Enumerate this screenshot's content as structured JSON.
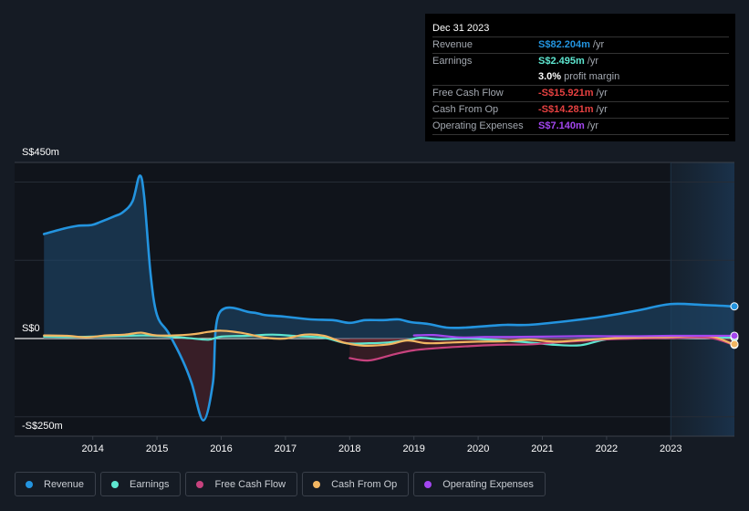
{
  "tooltip": {
    "date": "Dec 31 2023",
    "rows": [
      {
        "label": "Revenue",
        "value": "S$82.204m",
        "suffix": "/yr",
        "color": "#2394df"
      },
      {
        "label": "Earnings",
        "value": "S$2.495m",
        "suffix": "/yr",
        "color": "#5ee6d0"
      },
      {
        "label": "",
        "value": "3.0%",
        "suffix": "profit margin",
        "color": "#ffffff"
      },
      {
        "label": "Free Cash Flow",
        "value": "-S$15.921m",
        "suffix": "/yr",
        "color": "#e64141"
      },
      {
        "label": "Cash From Op",
        "value": "-S$14.281m",
        "suffix": "/yr",
        "color": "#e64141"
      },
      {
        "label": "Operating Expenses",
        "value": "S$7.140m",
        "suffix": "/yr",
        "color": "#a346f0"
      }
    ]
  },
  "legend": [
    {
      "label": "Revenue",
      "color": "#2394df"
    },
    {
      "label": "Earnings",
      "color": "#5ee6d0"
    },
    {
      "label": "Free Cash Flow",
      "color": "#c7427e"
    },
    {
      "label": "Cash From Op",
      "color": "#f2b662"
    },
    {
      "label": "Operating Expenses",
      "color": "#a346f0"
    }
  ],
  "chart_data": {
    "type": "area",
    "title": "",
    "xlabel": "",
    "ylabel": "",
    "currency": "S$",
    "unit": "m",
    "ylim": [
      -250,
      450
    ],
    "xlim": [
      2012.65,
      2023.98
    ],
    "y_tick_labels": [
      {
        "value": 450,
        "label": "S$450m"
      },
      {
        "value": 0,
        "label": "S$0"
      },
      {
        "value": -250,
        "label": "-S$250m"
      }
    ],
    "y_gridlines": [
      450,
      400,
      200,
      0,
      -200
    ],
    "x_ticks": [
      2014,
      2015,
      2016,
      2017,
      2018,
      2019,
      2020,
      2021,
      2022,
      2023
    ],
    "highlight_from": 2023.0,
    "grid": true,
    "legend_position": "bottom-left",
    "series": [
      {
        "name": "Revenue",
        "color": "#2394df",
        "fill": true,
        "points": [
          [
            2013.24,
            267
          ],
          [
            2013.55,
            281
          ],
          [
            2013.76,
            288
          ],
          [
            2013.98,
            290
          ],
          [
            2014.12,
            298
          ],
          [
            2014.33,
            312
          ],
          [
            2014.47,
            323
          ],
          [
            2014.62,
            351
          ],
          [
            2014.73,
            416
          ],
          [
            2014.8,
            363
          ],
          [
            2014.9,
            165
          ],
          [
            2015.0,
            60
          ],
          [
            2015.18,
            14
          ],
          [
            2015.4,
            -56
          ],
          [
            2015.54,
            -114
          ],
          [
            2015.72,
            -209
          ],
          [
            2015.87,
            -114
          ],
          [
            2015.97,
            65
          ],
          [
            2016.46,
            67
          ],
          [
            2016.68,
            60
          ],
          [
            2016.99,
            56
          ],
          [
            2017.39,
            49
          ],
          [
            2017.74,
            47
          ],
          [
            2018.0,
            40
          ],
          [
            2018.24,
            47
          ],
          [
            2018.52,
            47
          ],
          [
            2018.76,
            49
          ],
          [
            2018.95,
            42
          ],
          [
            2019.23,
            37
          ],
          [
            2019.51,
            28
          ],
          [
            2019.8,
            28
          ],
          [
            2020.23,
            33
          ],
          [
            2020.44,
            35
          ],
          [
            2020.79,
            35
          ],
          [
            2021.36,
            44
          ],
          [
            2021.93,
            56
          ],
          [
            2022.49,
            72
          ],
          [
            2022.99,
            88
          ],
          [
            2023.49,
            86
          ],
          [
            2023.97,
            82.2
          ]
        ]
      },
      {
        "name": "Earnings",
        "color": "#5ee6d0",
        "fill": false,
        "points": [
          [
            2013.24,
            5
          ],
          [
            2013.6,
            4
          ],
          [
            2014.0,
            5
          ],
          [
            2014.5,
            7
          ],
          [
            2014.8,
            8
          ],
          [
            2015.2,
            5
          ],
          [
            2015.5,
            1
          ],
          [
            2015.8,
            -3
          ],
          [
            2016.0,
            5
          ],
          [
            2016.4,
            7
          ],
          [
            2016.8,
            10
          ],
          [
            2017.2,
            6
          ],
          [
            2017.6,
            2
          ],
          [
            2017.95,
            -12
          ],
          [
            2018.3,
            -12
          ],
          [
            2018.6,
            -10
          ],
          [
            2018.9,
            -4
          ],
          [
            2019.1,
            2
          ],
          [
            2019.4,
            -2
          ],
          [
            2019.8,
            0
          ],
          [
            2020.3,
            -4
          ],
          [
            2020.8,
            -10
          ],
          [
            2021.2,
            -16
          ],
          [
            2021.6,
            -17
          ],
          [
            2022.0,
            -2
          ],
          [
            2022.5,
            1
          ],
          [
            2023.0,
            1
          ],
          [
            2023.5,
            3
          ],
          [
            2023.97,
            2.5
          ]
        ]
      },
      {
        "name": "Free Cash Flow",
        "color": "#c7427e",
        "fill": false,
        "points": [
          [
            2018.0,
            -50
          ],
          [
            2018.3,
            -56
          ],
          [
            2018.7,
            -40
          ],
          [
            2019.0,
            -30
          ],
          [
            2019.4,
            -24
          ],
          [
            2019.8,
            -20
          ],
          [
            2020.3,
            -16
          ],
          [
            2020.8,
            -15
          ],
          [
            2021.2,
            -10
          ],
          [
            2021.6,
            -6
          ],
          [
            2022.0,
            -2
          ],
          [
            2022.5,
            0
          ],
          [
            2023.0,
            1
          ],
          [
            2023.6,
            2
          ],
          [
            2023.97,
            -15.9
          ]
        ]
      },
      {
        "name": "Cash From Op",
        "color": "#f2b662",
        "fill": false,
        "points": [
          [
            2013.24,
            8
          ],
          [
            2013.6,
            7
          ],
          [
            2013.9,
            3
          ],
          [
            2014.2,
            8
          ],
          [
            2014.5,
            10
          ],
          [
            2014.75,
            15
          ],
          [
            2015.0,
            8
          ],
          [
            2015.5,
            10
          ],
          [
            2015.8,
            17
          ],
          [
            2016.0,
            20
          ],
          [
            2016.3,
            15
          ],
          [
            2016.7,
            2
          ],
          [
            2017.0,
            0
          ],
          [
            2017.3,
            10
          ],
          [
            2017.6,
            7
          ],
          [
            2017.9,
            -10
          ],
          [
            2018.2,
            -18
          ],
          [
            2018.6,
            -15
          ],
          [
            2018.9,
            -5
          ],
          [
            2019.2,
            -12
          ],
          [
            2019.6,
            -10
          ],
          [
            2020.0,
            -8
          ],
          [
            2020.4,
            -7
          ],
          [
            2020.8,
            -3
          ],
          [
            2021.2,
            -8
          ],
          [
            2021.6,
            -4
          ],
          [
            2022.0,
            0
          ],
          [
            2022.5,
            3
          ],
          [
            2023.0,
            4
          ],
          [
            2023.6,
            6
          ],
          [
            2023.97,
            -14.3
          ]
        ]
      },
      {
        "name": "Operating Expenses",
        "color": "#a346f0",
        "fill": false,
        "points": [
          [
            2019.0,
            8
          ],
          [
            2019.3,
            9
          ],
          [
            2019.7,
            3
          ],
          [
            2020.1,
            4
          ],
          [
            2020.5,
            4
          ],
          [
            2021.0,
            5
          ],
          [
            2021.5,
            6
          ],
          [
            2022.0,
            6
          ],
          [
            2022.5,
            6
          ],
          [
            2023.0,
            7
          ],
          [
            2023.5,
            7
          ],
          [
            2023.97,
            7.1
          ]
        ]
      }
    ]
  }
}
